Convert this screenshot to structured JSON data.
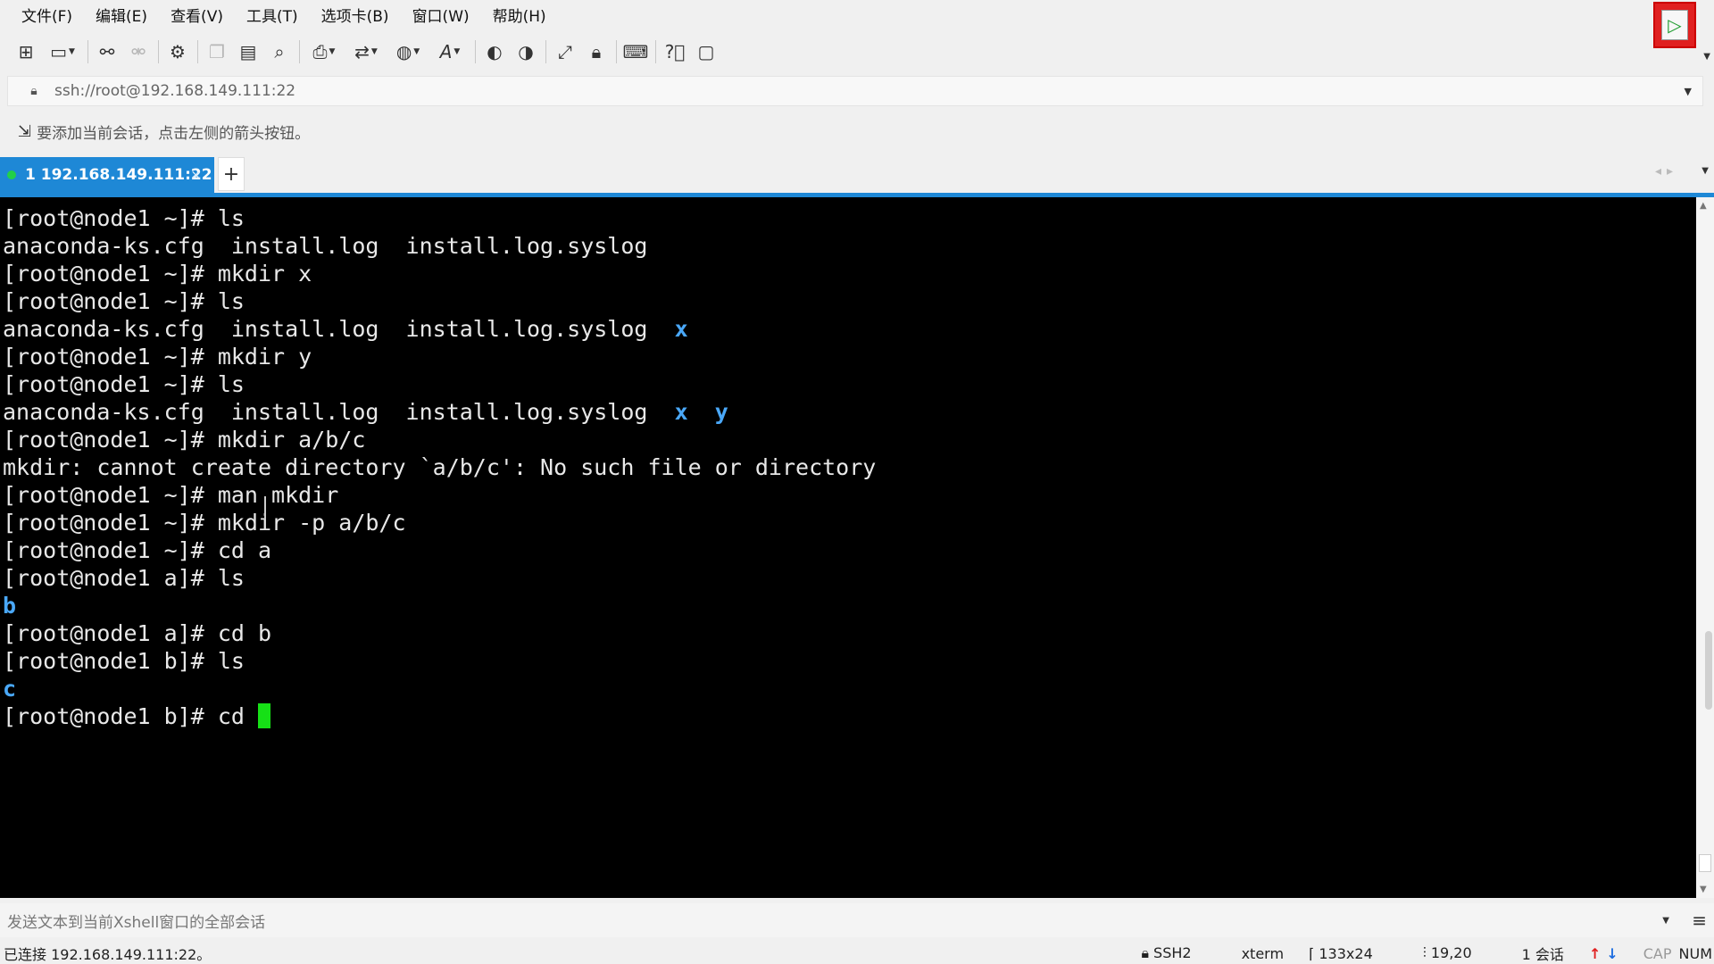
{
  "menu": {
    "items": [
      "文件(F)",
      "编辑(E)",
      "查看(V)",
      "工具(T)",
      "选项卡(B)",
      "窗口(W)",
      "帮助(H)"
    ]
  },
  "toolbar": {
    "icons": [
      "new-session-icon",
      "open-folder-icon",
      "reconnect-icon",
      "disconnect-icon",
      "session-properties-icon",
      "copy-icon",
      "paste-icon",
      "find-icon",
      "print-icon",
      "transfer-icon",
      "globe-icon",
      "font-icon",
      "xftp-icon",
      "xshell-icon",
      "fullscreen-icon",
      "lock-icon",
      "keyboard-icon",
      "help-icon",
      "chat-icon"
    ]
  },
  "address": {
    "url": "ssh://root@192.168.149.111:22"
  },
  "hint": {
    "text": "要添加当前会话，点击左侧的箭头按钮。"
  },
  "tabs": {
    "active_label": "1 192.168.149.111:22",
    "close": "×",
    "add": "+"
  },
  "terminal": {
    "l1": "[root@node1 ~]# ls",
    "l2": "anaconda-ks.cfg  install.log  install.log.syslog",
    "l3": "[root@node1 ~]# mkdir x",
    "l4": "[root@node1 ~]# ls",
    "l5a": "anaconda-ks.cfg  install.log  install.log.syslog  ",
    "l5b": "x",
    "l6": "[root@node1 ~]# mkdir y",
    "l7": "[root@node1 ~]# ls",
    "l8a": "anaconda-ks.cfg  install.log  install.log.syslog  ",
    "l8b": "x",
    "l8c": "  ",
    "l8d": "y",
    "l9": "[root@node1 ~]# mkdir a/b/c",
    "l10": "mkdir: cannot create directory `a/b/c': No such file or directory",
    "l11": "[root@node1 ~]# man mkdir",
    "l12": "[root@node1 ~]# mkdir -p a/b/c",
    "l13": "[root@node1 ~]# cd a",
    "l14": "[root@node1 a]# ls",
    "l15": "b",
    "l16": "[root@node1 a]# cd b",
    "l17": "[root@node1 b]# ls",
    "l18": "c",
    "l19": "[root@node1 b]# cd "
  },
  "sendbar": {
    "placeholder": "发送文本到当前Xshell窗口的全部会话"
  },
  "status": {
    "connection": "已连接 192.168.149.111:22。",
    "protocol": "SSH2",
    "term": "xterm",
    "size": "133x24",
    "cursor_pos": "19,20",
    "sessions": "1 会话",
    "cap": "CAP",
    "num": "NUM"
  },
  "colors": {
    "accent": "#1e88d6",
    "directory": "#4aa8f8",
    "cursor": "#16e016"
  }
}
